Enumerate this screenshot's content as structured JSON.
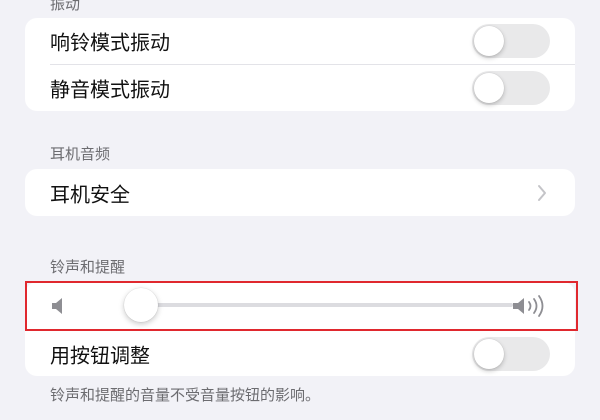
{
  "vibration": {
    "section_label": "振动",
    "ring_mode": {
      "label": "响铃模式振动",
      "enabled": false
    },
    "silent_mode": {
      "label": "静音模式振动",
      "enabled": false
    }
  },
  "headphone_audio": {
    "section_label": "耳机音频",
    "headphone_safety": {
      "label": "耳机安全",
      "chevron_icon": "chevron-right-icon"
    }
  },
  "ringer_alerts": {
    "section_label": "铃声和提醒",
    "volume_level": 0.04,
    "volume_min_icon": "speaker-low-icon",
    "volume_max_icon": "speaker-high-icon",
    "change_with_buttons": {
      "label": "用按钮调整",
      "enabled": false
    },
    "footer_note": "铃声和提醒的音量不受音量按钮的影响。"
  },
  "colors": {
    "background": "#f2f2f7",
    "group_background": "#ffffff",
    "toggle_off": "#e9e9ea",
    "secondary_text": "#6c6c70",
    "highlight_border": "#e0282e"
  }
}
